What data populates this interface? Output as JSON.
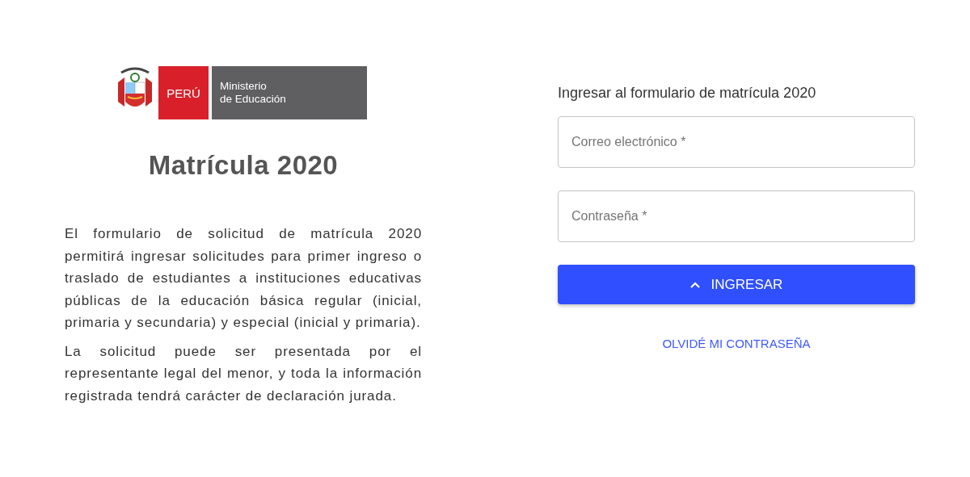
{
  "logo": {
    "country": "PERÚ",
    "ministry_line_1": "Ministerio",
    "ministry_line_2": "de Educación"
  },
  "title": "Matrícula 2020",
  "paragraphs": [
    "El formulario de solicitud de matrícula 2020 permitirá ingresar solicitudes para primer ingreso o traslado de estudiantes a instituciones educativas públicas de la educación básica regular (inicial, primaria y secundaria) y especial (inicial y primaria).",
    "La solicitud puede ser presentada por el representante legal del menor, y toda la información registrada tendrá carácter de declaración jurada."
  ],
  "login": {
    "heading": "Ingresar al formulario de matrícula 2020",
    "fields": [
      {
        "placeholder": "Correo electrónico *"
      },
      {
        "placeholder": "Contraseña *"
      }
    ],
    "submit": "INGRESAR",
    "forgot_link": "OLVIDÉ MI CONTRASEÑA"
  }
}
